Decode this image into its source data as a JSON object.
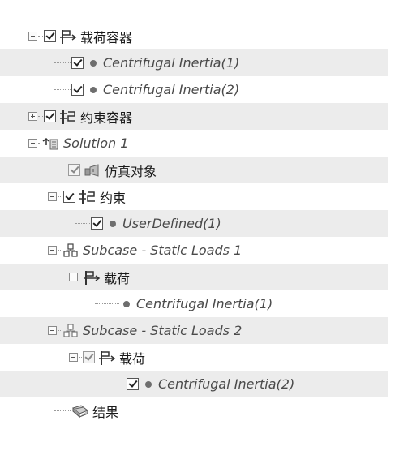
{
  "tree": {
    "rows": [
      {
        "label": "载荷容器",
        "expander": "minus",
        "checkbox": "checked",
        "icon": "load-flag-icon",
        "italic": false
      },
      {
        "label": "Centrifugal Inertia(1)",
        "checkbox": "checked",
        "icon": "bullet-icon",
        "italic": true
      },
      {
        "label": "Centrifugal Inertia(2)",
        "checkbox": "checked",
        "icon": "bullet-icon",
        "italic": true
      },
      {
        "label": "约束容器",
        "expander": "plus",
        "checkbox": "checked",
        "icon": "constraint-icon",
        "italic": false
      },
      {
        "label": "Solution 1",
        "expander": "minus",
        "icon": "solution-icon",
        "italic": true
      },
      {
        "label": "仿真对象",
        "checkbox": "greyed",
        "icon": "simulation-object-icon",
        "italic": false
      },
      {
        "label": "约束",
        "expander": "minus",
        "checkbox": "checked",
        "icon": "constraint-icon",
        "italic": false
      },
      {
        "label": "UserDefined(1)",
        "checkbox": "checked",
        "icon": "bullet-icon",
        "italic": true
      },
      {
        "label": "Subcase - Static Loads 1",
        "expander": "minus",
        "icon": "subcase-icon",
        "italic": true
      },
      {
        "label": "载荷",
        "expander": "minus",
        "icon": "load-flag-icon",
        "italic": false
      },
      {
        "label": "Centrifugal Inertia(1)",
        "icon": "bullet-icon",
        "italic": true
      },
      {
        "label": "Subcase - Static Loads 2",
        "expander": "minus",
        "icon": "subcase-icon",
        "italic": true
      },
      {
        "label": "载荷",
        "expander": "minus",
        "checkbox": "greyed",
        "icon": "load-flag-icon",
        "italic": false
      },
      {
        "label": "Centrifugal Inertia(2)",
        "checkbox": "checked",
        "icon": "bullet-icon",
        "italic": true
      },
      {
        "label": "结果",
        "icon": "results-icon",
        "italic": false
      }
    ]
  }
}
